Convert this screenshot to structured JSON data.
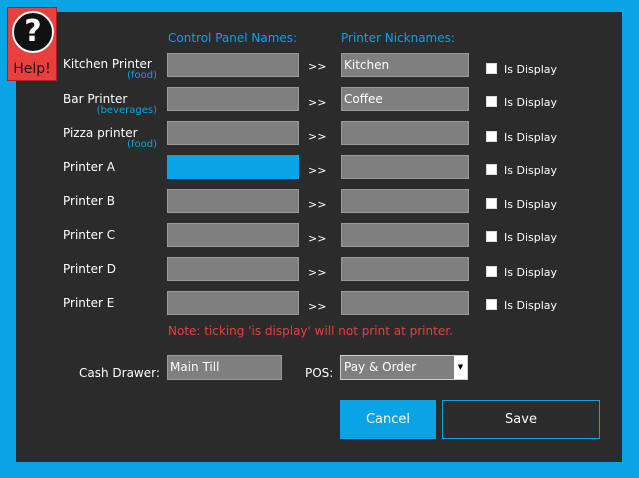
{
  "help": {
    "icon": "question-mark-icon",
    "glyph": "?",
    "label": "Help!"
  },
  "headers": {
    "control": "Control Panel Names:",
    "nick": "Printer Nicknames:"
  },
  "arrow_glyph": ">>",
  "display_label": "Is Display",
  "printers": [
    {
      "name": "Kitchen Printer",
      "sub": "(food)",
      "control": "",
      "nickname": "Kitchen",
      "is_display": false
    },
    {
      "name": "Bar Printer",
      "sub": "(beverages)",
      "control": "",
      "nickname": "Coffee",
      "is_display": false
    },
    {
      "name": "Pizza printer",
      "sub": "(food)",
      "control": "",
      "nickname": "",
      "is_display": false
    },
    {
      "name": "Printer A",
      "sub": "",
      "control": "",
      "nickname": "",
      "is_display": false
    },
    {
      "name": "Printer B",
      "sub": "",
      "control": "",
      "nickname": "",
      "is_display": false
    },
    {
      "name": "Printer C",
      "sub": "",
      "control": "",
      "nickname": "",
      "is_display": false
    },
    {
      "name": "Printer D",
      "sub": "",
      "control": "",
      "nickname": "",
      "is_display": false
    },
    {
      "name": "Printer E",
      "sub": "",
      "control": "",
      "nickname": "",
      "is_display": false
    }
  ],
  "note": "Note: ticking 'is display' will not print at printer.",
  "cash_drawer": {
    "label": "Cash Drawer:",
    "value": "Main Till"
  },
  "pos": {
    "label": "POS:",
    "value": "Pay & Order"
  },
  "buttons": {
    "cancel": "Cancel",
    "save": "Save"
  },
  "colors": {
    "accent": "#0aa3e6",
    "panel": "#2b2b2b",
    "field": "#7f7f7f",
    "warning": "#e9403e"
  }
}
